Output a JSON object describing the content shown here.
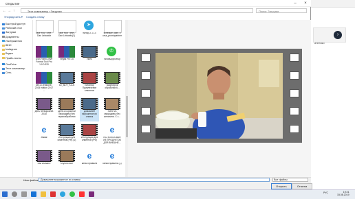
{
  "window": {
    "title": "Открытие"
  },
  "address": {
    "path": "Этот компьютер  ›  Загрузки",
    "search_placeholder": "Поиск: Загрузки"
  },
  "toolbar": {
    "organize": "Упорядочить ▾",
    "new_folder": "Создать папку"
  },
  "nav": {
    "items": [
      {
        "label": "Быстрый доступ",
        "color": "#2f7fd8"
      },
      {
        "label": "Рабочий стол",
        "color": "#4a90d9"
      },
      {
        "label": "Загрузки",
        "color": "#2a6ed0"
      },
      {
        "label": "Документы",
        "color": "#8a8a8a"
      },
      {
        "label": "Изображения",
        "color": "#3fa0e0"
      },
      {
        "label": "8810",
        "color": "#e8c25a"
      },
      {
        "label": "Instagram",
        "color": "#e8c25a"
      },
      {
        "label": "Видео",
        "color": "#e8c25a"
      },
      {
        "label": "Прайс-листы",
        "color": "#e8c25a"
      },
      {
        "label": "OneDrive",
        "color": "#2f86d6"
      },
      {
        "label": "Этот компьютер",
        "color": "#4a8ed8"
      },
      {
        "label": "Сеть",
        "color": "#4a8ed8"
      }
    ]
  },
  "files": [
    {
      "name": "Take Your Time - Dan Lebowitz",
      "kind": "doc"
    },
    {
      "name": "Take Your Time - Dan Lebowitz(1)",
      "kind": "doc"
    },
    {
      "name": "tsetup.2.1.13",
      "kind": "telegram"
    },
    {
      "name": "schedule_plan_k ursa_promopartner",
      "kind": "word"
    },
    {
      "name": "USB Flash Drive Format Tool Pro 1.0.0.320",
      "kind": "rar"
    },
    {
      "name": "Vegas Pro 15",
      "kind": "rar"
    },
    {
      "name": "video",
      "kind": "film"
    },
    {
      "name": "WhatsAppSetup",
      "kind": "whatsapp"
    },
    {
      "name": "win10-redstone-2015 edition 2017 ...",
      "kind": "rar"
    },
    {
      "name": "xD_aKFf_rGOk",
      "kind": "photo"
    },
    {
      "name": "Вебинар Привлечение клиентов",
      "kind": "film"
    },
    {
      "name": "Видеоурок обработки 6...",
      "kind": "film"
    },
    {
      "name": "день нетворкинга 2018",
      "kind": "film"
    },
    {
      "name": "Днем из красной смородины без термообработки",
      "kind": "film"
    },
    {
      "name": "Домашнее мороженое из сливок",
      "kind": "film"
    },
    {
      "name": "Желе из смородины без желатина. С к...",
      "kind": "film"
    },
    {
      "name": "Жжжк",
      "kind": "edge"
    },
    {
      "name": "Инструкция для клиентов (РФ) (1)",
      "kind": "film"
    },
    {
      "name": "Инструкция для клиентов (РФ)",
      "kind": "film"
    },
    {
      "name": "ИСПОЛЬЗОВАН ИЕ ПРОДУКТОВ ДЛЯ ВНЕШНЕ...",
      "kind": "pdf"
    },
    {
      "name": "Как снимать",
      "kind": "film"
    },
    {
      "name": "Клубничное",
      "kind": "film"
    },
    {
      "name": "кинья правила",
      "kind": "edge"
    },
    {
      "name": "кинья правила (1)",
      "kind": "pdf"
    }
  ],
  "bottom": {
    "filename_label": "Имя файла:",
    "filename_value": "Домашнее мороженое из сливок",
    "type_value": "Все файлы",
    "open_label": "Открыть",
    "cancel_label": "Отмена"
  },
  "background_site": {
    "text": "ателико"
  },
  "clock": {
    "time": "19:21",
    "date": "15.08.2019",
    "lang": "РУС"
  }
}
